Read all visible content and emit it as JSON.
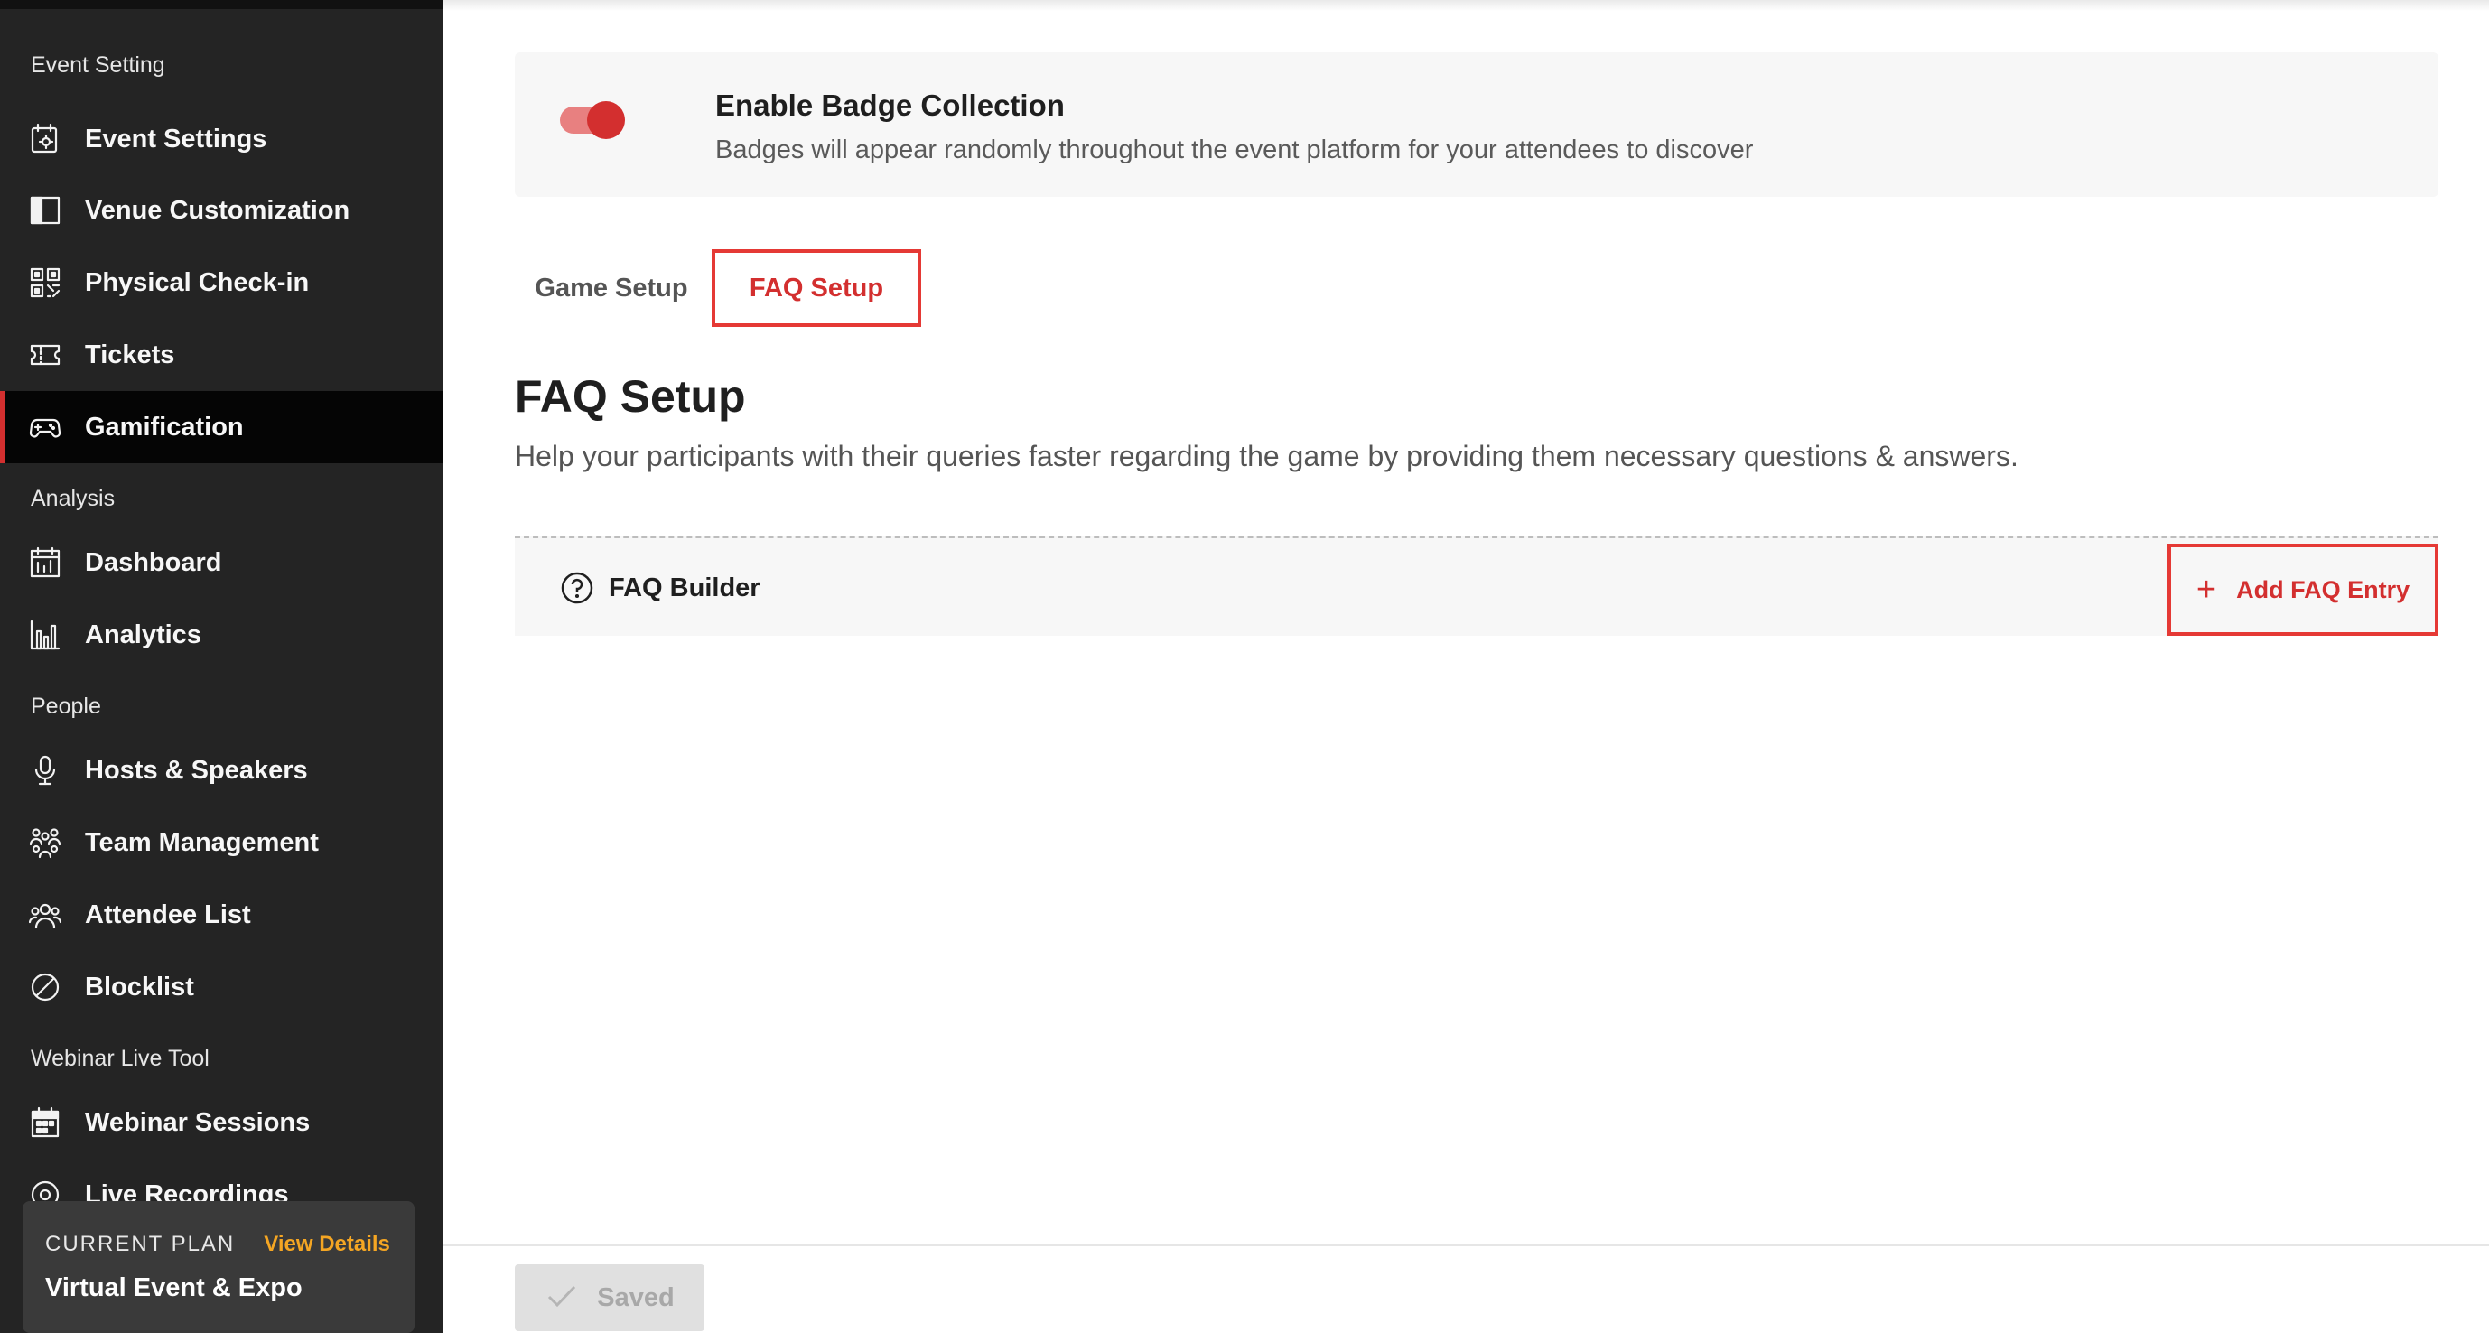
{
  "sidebar": {
    "sections": {
      "event_setting": "Event Setting",
      "analysis": "Analysis",
      "people": "People",
      "webinar": "Webinar Live Tool"
    },
    "items": {
      "event_settings": "Event Settings",
      "venue_customization": "Venue Customization",
      "physical_checkin": "Physical Check-in",
      "tickets": "Tickets",
      "gamification": "Gamification",
      "dashboard": "Dashboard",
      "analytics": "Analytics",
      "hosts_speakers": "Hosts & Speakers",
      "team_management": "Team Management",
      "attendee_list": "Attendee List",
      "blocklist": "Blocklist",
      "webinar_sessions": "Webinar Sessions",
      "live_recordings": "Live Recordings"
    },
    "active_item": "Gamification",
    "plan": {
      "label": "CURRENT PLAN",
      "link": "View Details",
      "name": "Virtual Event & Expo"
    }
  },
  "badge_collection": {
    "enabled": true,
    "title": "Enable Badge Collection",
    "description": "Badges will appear randomly throughout the event platform for your attendees to discover"
  },
  "tabs": {
    "game_setup": "Game Setup",
    "faq_setup": "FAQ Setup",
    "active": "FAQ Setup"
  },
  "faq": {
    "title": "FAQ Setup",
    "description": "Help your participants with their queries faster regarding the game by providing them necessary questions & answers.",
    "builder_title": "FAQ Builder",
    "add_button": "Add FAQ Entry"
  },
  "footer": {
    "saved_label": "Saved"
  },
  "colors": {
    "accent": "#d32f2f",
    "sidebar_bg": "#242424",
    "plan_link": "#f5a623"
  }
}
